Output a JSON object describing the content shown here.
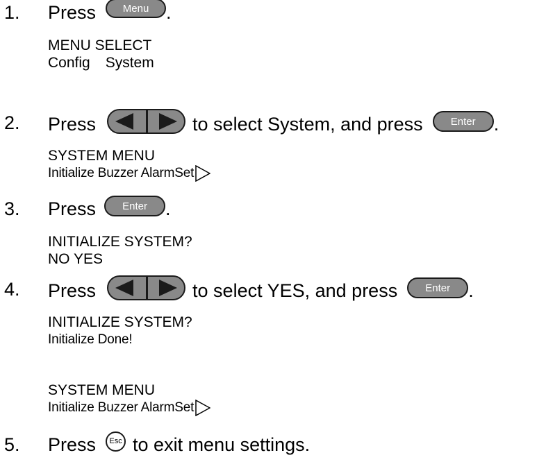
{
  "steps": [
    {
      "num": "1.",
      "press": "Press",
      "key": "Menu",
      "after": "."
    },
    {
      "num": "2.",
      "press": "Press",
      "middle": "to select System, and press",
      "key": "Enter",
      "after": "."
    },
    {
      "num": "3.",
      "press": "Press",
      "key": "Enter",
      "after": "."
    },
    {
      "num": "4.",
      "press": "Press",
      "middle": "to select YES, and press",
      "key": "Enter",
      "after": "."
    },
    {
      "num": "5.",
      "press": "Press",
      "key": "Esc",
      "middle": "to exit menu settings."
    }
  ],
  "displays": {
    "menu_select": {
      "line1": "MENU SELECT",
      "opt1": "Config",
      "opt2": "System"
    },
    "system_menu_1": {
      "line1": "SYSTEM MENU",
      "line2": "Initialize Buzzer AlarmSet"
    },
    "init_confirm": {
      "line1": "INITIALIZE SYSTEM?",
      "line2": "NO YES"
    },
    "init_done": {
      "line1": "INITIALIZE SYSTEM?",
      "line2": "Initialize Done!"
    },
    "system_menu_2": {
      "line1": "SYSTEM MENU",
      "line2": "Initialize Buzzer AlarmSet"
    }
  },
  "icons": {
    "arrow_keys": "left-right-arrow-keys-icon",
    "scroll_indicator": "right-triangle-outline-icon",
    "esc": "esc-key-icon"
  },
  "colors": {
    "key_fill": "#898989",
    "key_border": "#1a1a1a",
    "text": "#000000"
  }
}
